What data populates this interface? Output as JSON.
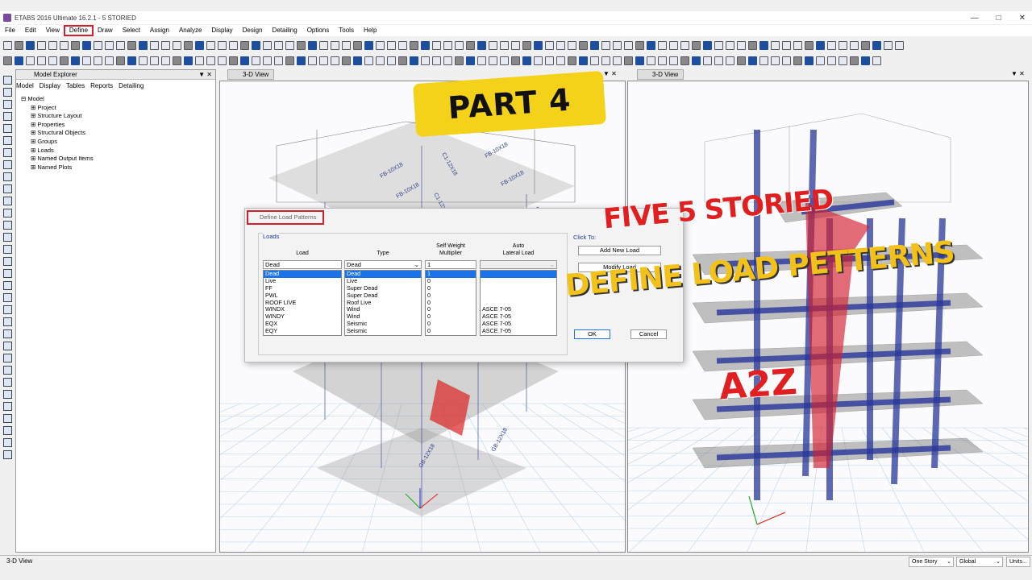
{
  "window": {
    "title": "ETABS 2016 Ultimate 16.2.1 - 5 STORIED"
  },
  "menu": [
    "File",
    "Edit",
    "View",
    "Define",
    "Draw",
    "Select",
    "Assign",
    "Analyze",
    "Display",
    "Design",
    "Detailing",
    "Options",
    "Tools",
    "Help"
  ],
  "explorer": {
    "title": "Model Explorer",
    "tabs": [
      "Model",
      "Display",
      "Tables",
      "Reports",
      "Detailing"
    ],
    "root": "Model",
    "items": [
      "Project",
      "Structure Layout",
      "Properties",
      "Structural Objects",
      "Groups",
      "Loads",
      "Named Output Items",
      "Named Plots"
    ]
  },
  "view_left": {
    "tab": "3-D View"
  },
  "view_right": {
    "tab": "3-D View"
  },
  "beam_labels": [
    "FB-10X18",
    "FB-10X18",
    "FB-10X18",
    "FB-10X18",
    "FB-10X18",
    "FB-10X18",
    "C1-12X18",
    "C1-12X18",
    "GB-12X18",
    "GB-12X18"
  ],
  "dialog": {
    "title": "Define Load Patterns",
    "group_label": "Loads",
    "col_load": "Load",
    "col_type": "Type",
    "col_sw": "Self Weight\nMultiplier",
    "col_auto": "Auto\nLateral Load",
    "input_load": "Dead",
    "input_type": "Dead",
    "input_sw": "1",
    "rows": [
      {
        "load": "Dead",
        "type": "Dead",
        "sw": "1",
        "auto": ""
      },
      {
        "load": "Live",
        "type": "Live",
        "sw": "0",
        "auto": ""
      },
      {
        "load": "FF",
        "type": "Super Dead",
        "sw": "0",
        "auto": ""
      },
      {
        "load": "PWL",
        "type": "Super Dead",
        "sw": "0",
        "auto": ""
      },
      {
        "load": "ROOF LIVE",
        "type": "Roof Live",
        "sw": "0",
        "auto": ""
      },
      {
        "load": "WINDX",
        "type": "Wind",
        "sw": "0",
        "auto": "ASCE 7-05"
      },
      {
        "load": "WINDY",
        "type": "Wind",
        "sw": "0",
        "auto": "ASCE 7-05"
      },
      {
        "load": "EQX",
        "type": "Seismic",
        "sw": "0",
        "auto": "ASCE 7-05"
      },
      {
        "load": "EQY",
        "type": "Seismic",
        "sw": "0",
        "auto": "ASCE 7-05"
      }
    ],
    "click_to": "Click To:",
    "add_btn": "Add New Load",
    "modify_btn": "Modify Load",
    "ok_btn": "OK",
    "cancel_btn": "Cancel"
  },
  "overlay": {
    "part": "PART 4",
    "five": "FIVE 5 STORIED",
    "define": "DEFINE LOAD PETTERNS",
    "a2z": "A2Z"
  },
  "status": {
    "left": "3-D View",
    "story": "One Story",
    "coord": "Global",
    "units": "Units..."
  },
  "colors": {
    "accent": "#d21f2f",
    "highlight": "#1a73e8",
    "frame": "#28379a",
    "part_bg": "#f4d21a"
  }
}
